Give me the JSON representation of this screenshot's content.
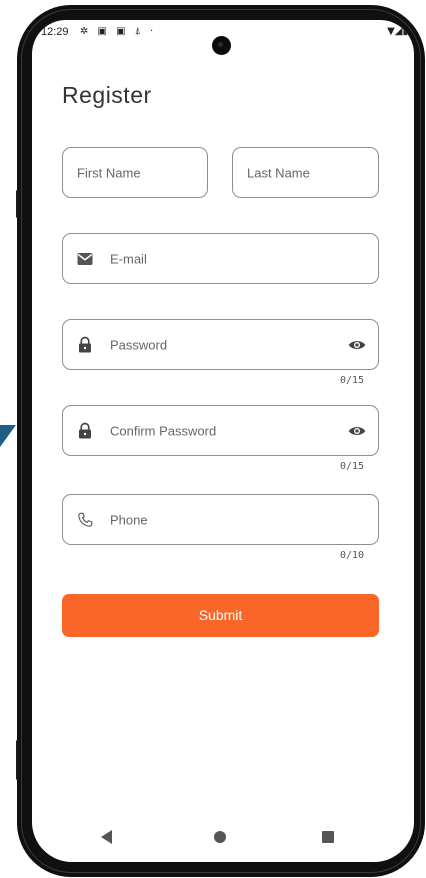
{
  "status_bar": {
    "time": "12:29",
    "left_icons": "✲ ▣ ▣ ⍋ ·",
    "right_icons": "▼◢▮"
  },
  "page": {
    "title": "Register"
  },
  "form": {
    "first_name": {
      "placeholder": "First Name"
    },
    "last_name": {
      "placeholder": "Last Name"
    },
    "email": {
      "placeholder": "E-mail",
      "icon": "mail-icon"
    },
    "password": {
      "placeholder": "Password",
      "icon": "lock-icon",
      "toggle_icon": "eye-icon",
      "counter": "0/15"
    },
    "confirm_password": {
      "placeholder": "Confirm Password",
      "icon": "lock-icon",
      "toggle_icon": "eye-icon",
      "counter": "0/15"
    },
    "phone": {
      "placeholder": "Phone",
      "icon": "phone-icon",
      "counter": "0/10"
    },
    "submit_label": "Submit"
  },
  "nav_bar": {
    "back_icon": "back-triangle-icon",
    "home_icon": "home-circle-icon",
    "recents_icon": "recents-square-icon"
  },
  "colors": {
    "accent": "#fa6628",
    "border": "#8e8e8e",
    "text": "#333333",
    "placeholder": "#666666",
    "frame": "#101010",
    "corner_mark": "#1f5d84"
  }
}
